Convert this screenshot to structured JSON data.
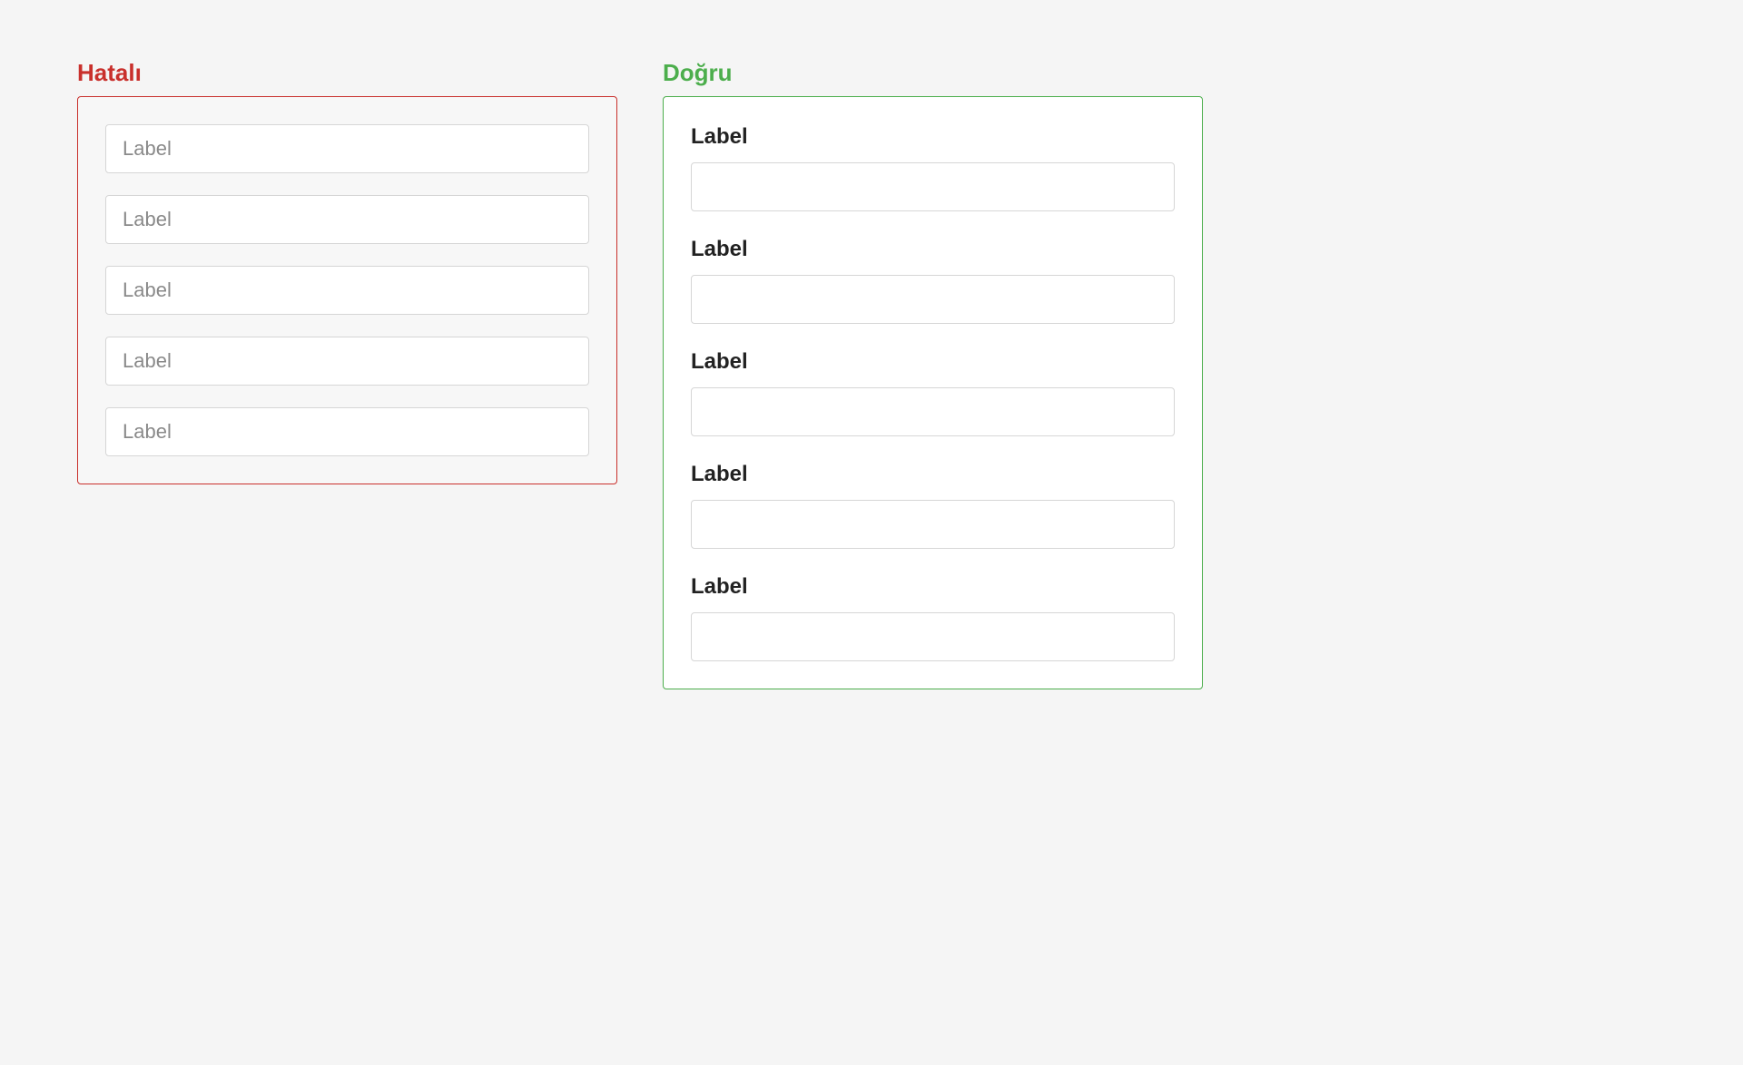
{
  "wrong": {
    "title": "Hatalı",
    "fields": [
      {
        "placeholder": "Label"
      },
      {
        "placeholder": "Label"
      },
      {
        "placeholder": "Label"
      },
      {
        "placeholder": "Label"
      },
      {
        "placeholder": "Label"
      }
    ]
  },
  "right": {
    "title": "Doğru",
    "fields": [
      {
        "label": "Label"
      },
      {
        "label": "Label"
      },
      {
        "label": "Label"
      },
      {
        "label": "Label"
      },
      {
        "label": "Label"
      }
    ]
  }
}
